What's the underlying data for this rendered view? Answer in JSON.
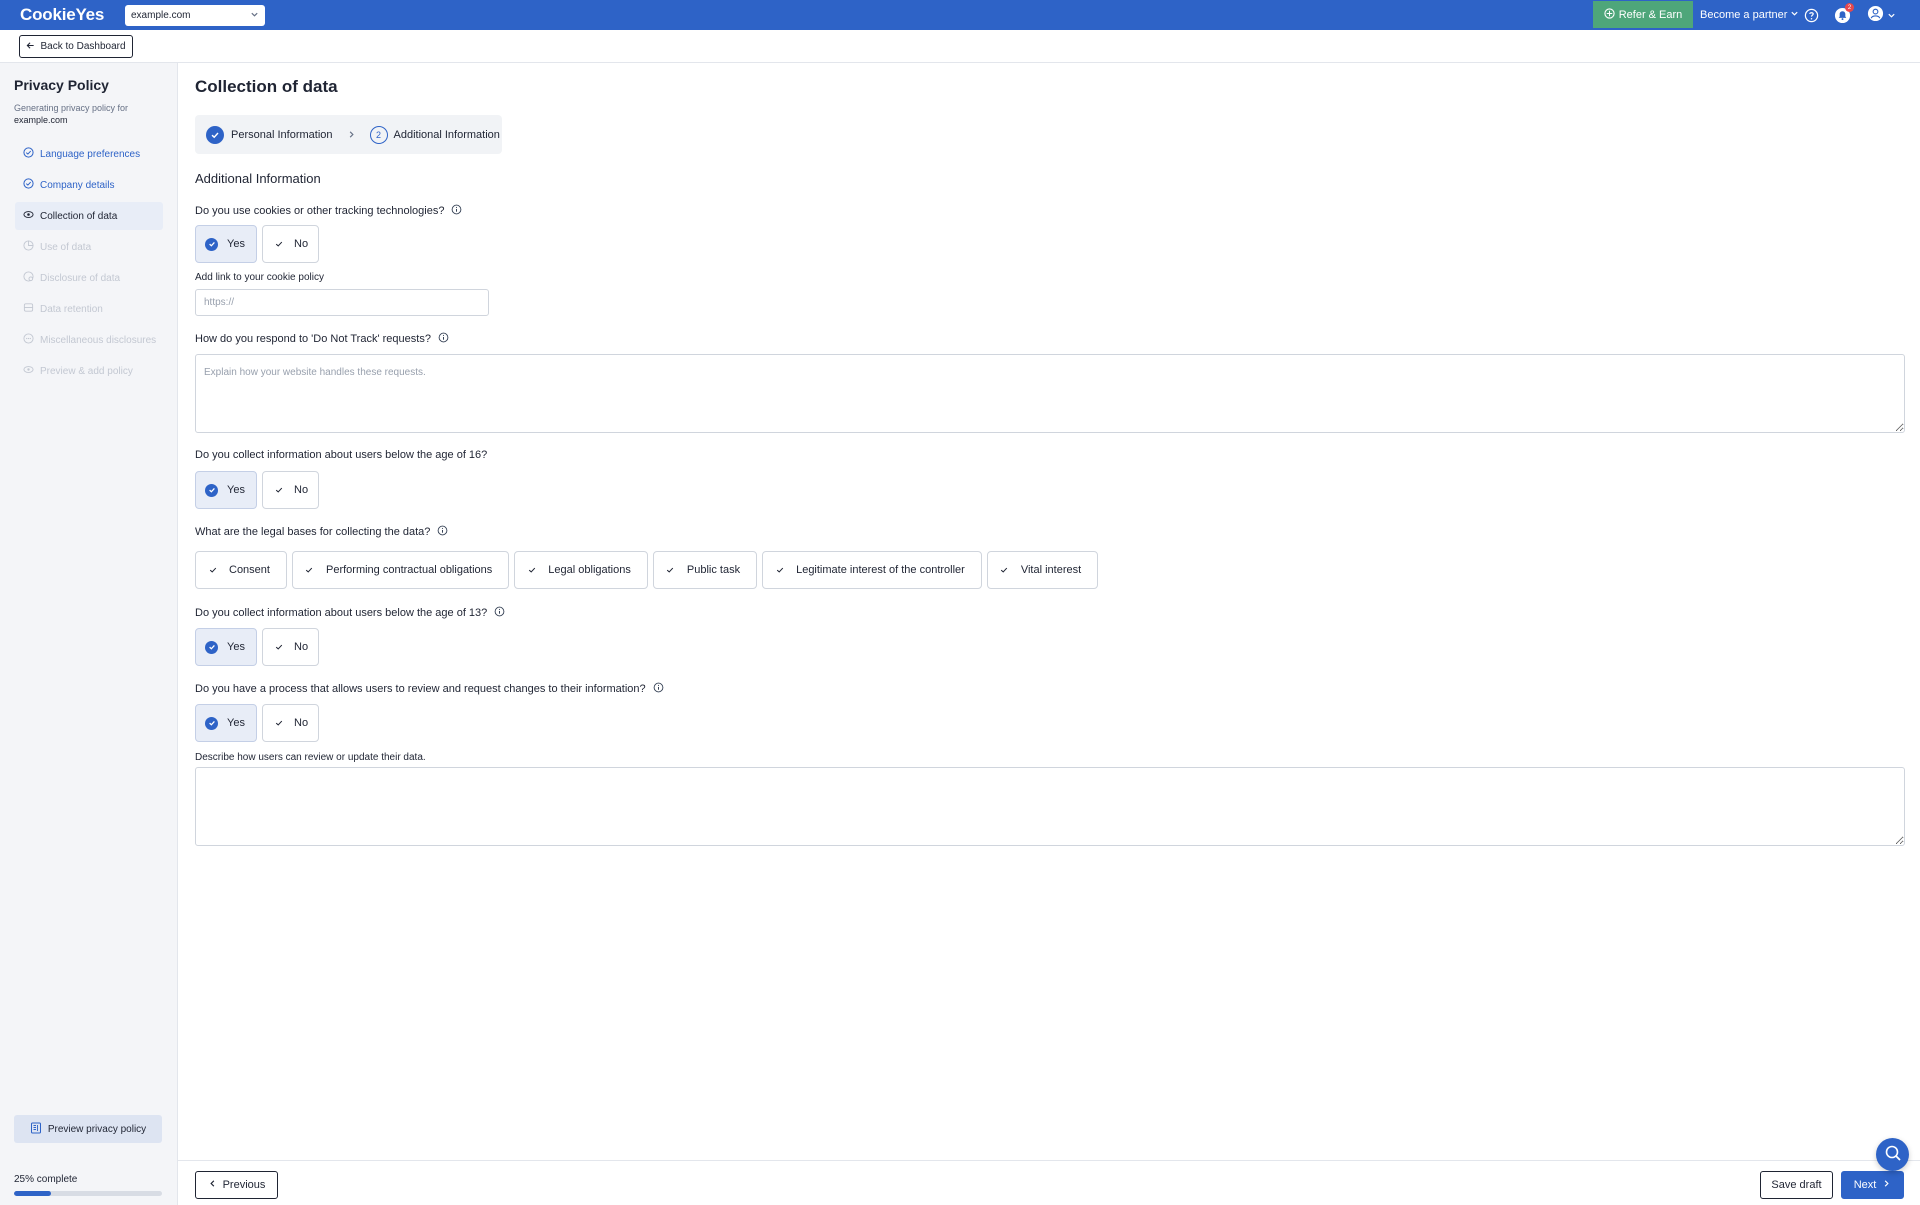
{
  "app": {
    "logo_text": "CookieYes",
    "site_selector_value": "example.com",
    "refer_label": "Refer & Earn",
    "partner_label": "Become a partner",
    "notification_count": "2",
    "back_label": "Back to Dashboard"
  },
  "colors": {
    "brand": "#2e63c7",
    "refer_green": "#4ea67a",
    "selected_bg": "#e8edf7"
  },
  "sidebar": {
    "title": "Privacy Policy",
    "subtitle": "Generating privacy policy for",
    "domain": "example.com",
    "items": [
      {
        "label": "Language preferences",
        "state": "done",
        "icon": "check-circle-icon"
      },
      {
        "label": "Company details",
        "state": "done",
        "icon": "check-circle-icon"
      },
      {
        "label": "Collection of data",
        "state": "active",
        "icon": "database-eye-icon"
      },
      {
        "label": "Use of data",
        "state": "disabled",
        "icon": "pie-chart-icon"
      },
      {
        "label": "Disclosure of data",
        "state": "disabled",
        "icon": "share-icon"
      },
      {
        "label": "Data retention",
        "state": "disabled",
        "icon": "database-icon"
      },
      {
        "label": "Miscellaneous disclosures",
        "state": "disabled",
        "icon": "dots-icon"
      },
      {
        "label": "Preview & add policy",
        "state": "disabled",
        "icon": "eye-icon"
      }
    ],
    "preview_label": "Preview privacy policy",
    "progress_label": "25% complete",
    "progress_value": 0.25
  },
  "main": {
    "title": "Collection of data",
    "steps": [
      {
        "label": "Personal Information",
        "state": "done"
      },
      {
        "label": "Additional Information",
        "number": "2",
        "state": "current"
      }
    ],
    "section_title": "Additional Information",
    "q_cookies": "Do you use cookies or other tracking technologies?",
    "cookie_link_label": "Add link to your cookie policy",
    "cookie_link_placeholder": "https://",
    "q_dnt": "How do you respond to 'Do Not Track' requests?",
    "dnt_placeholder": "Explain how your website handles these requests.",
    "q_age16": "Do you collect information about users below the age of 16?",
    "q_bases": "What are the legal bases for collecting the data?",
    "bases": [
      "Consent",
      "Performing contractual obligations",
      "Legal obligations",
      "Public task",
      "Legitimate interest of the controller",
      "Vital interest"
    ],
    "q_age13": "Do you collect information about users below the age of 13?",
    "q_review": "Do you have a process that allows users to review and request changes to their information?",
    "review_label": "Describe how users can review or update their data.",
    "yes_label": "Yes",
    "no_label": "No"
  },
  "footer": {
    "previous_label": "Previous",
    "save_label": "Save draft",
    "next_label": "Next"
  }
}
